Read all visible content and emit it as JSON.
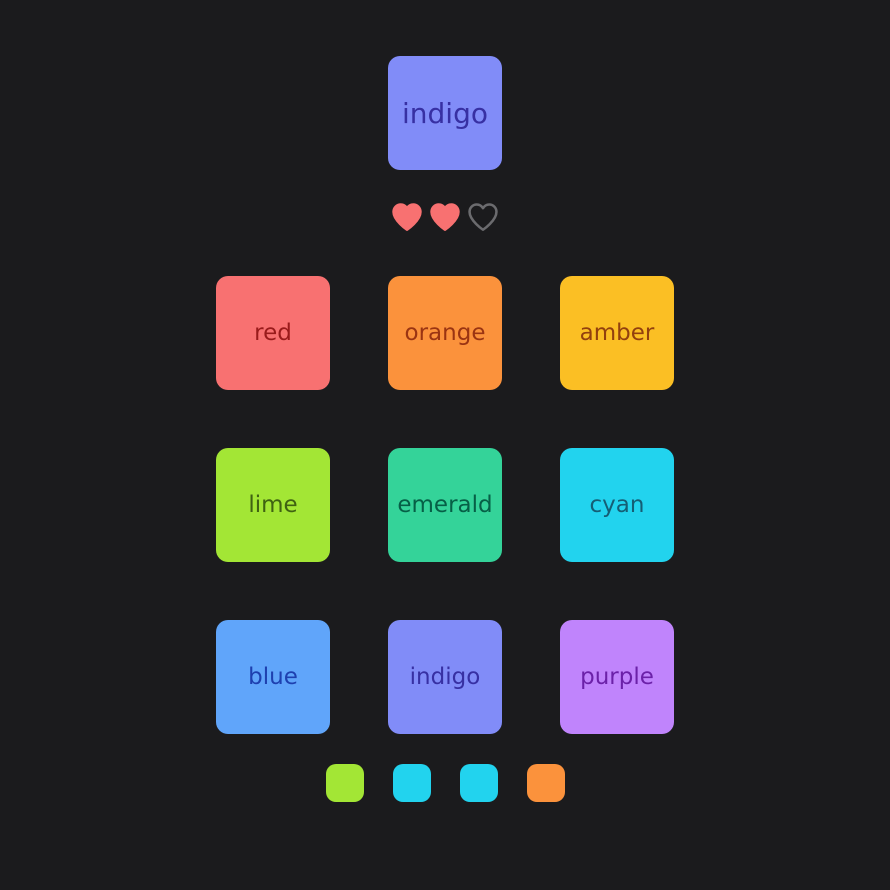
{
  "target": {
    "label": "indigo",
    "color": "#818cf8",
    "text_color": "#3730a3"
  },
  "lives": {
    "remaining": 2,
    "total": 3,
    "full_color": "#f87171",
    "empty_color": "#6b6b6e"
  },
  "grid": [
    {
      "label": "red",
      "color": "#f87171",
      "text_color": "#991b1b"
    },
    {
      "label": "orange",
      "color": "#fb923c",
      "text_color": "#9a3412"
    },
    {
      "label": "amber",
      "color": "#fbbf24",
      "text_color": "#92400e"
    },
    {
      "label": "lime",
      "color": "#a3e635",
      "text_color": "#3f6212"
    },
    {
      "label": "emerald",
      "color": "#34d399",
      "text_color": "#065f46"
    },
    {
      "label": "cyan",
      "color": "#22d3ee",
      "text_color": "#155e75"
    },
    {
      "label": "blue",
      "color": "#60a5fa",
      "text_color": "#1e40af"
    },
    {
      "label": "indigo",
      "color": "#818cf8",
      "text_color": "#3730a3"
    },
    {
      "label": "purple",
      "color": "#c084fc",
      "text_color": "#6b21a8"
    }
  ],
  "history": [
    {
      "name": "lime",
      "color": "#a3e635"
    },
    {
      "name": "cyan",
      "color": "#22d3ee"
    },
    {
      "name": "cyan",
      "color": "#22d3ee"
    },
    {
      "name": "orange",
      "color": "#fb923c"
    }
  ]
}
